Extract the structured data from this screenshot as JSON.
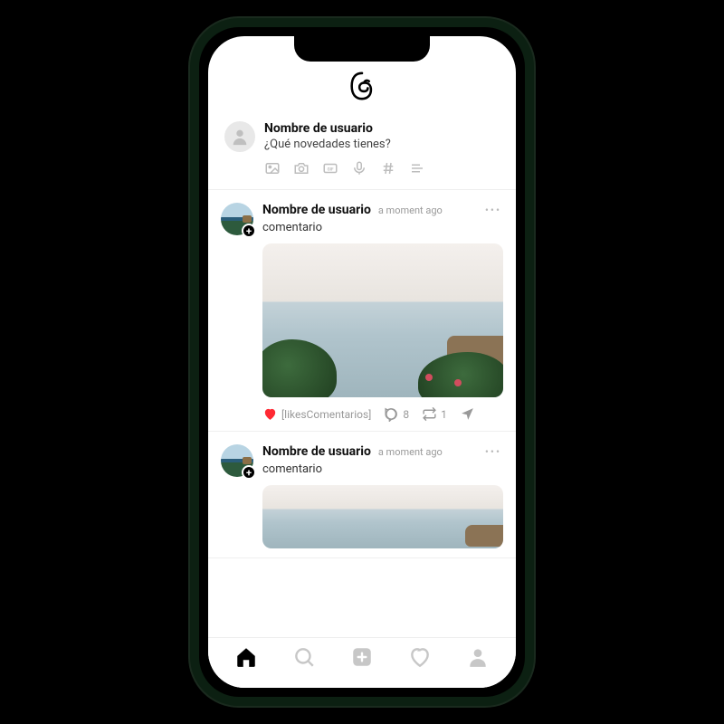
{
  "compose": {
    "username": "Nombre de usuario",
    "prompt": "¿Qué novedades tienes?"
  },
  "posts": [
    {
      "username": "Nombre de usuario",
      "time": "a moment ago",
      "text": "comentario",
      "likes_label": "[likesComentarios]",
      "comments": "8",
      "reposts": "1"
    },
    {
      "username": "Nombre de usuario",
      "time": "a moment ago",
      "text": "comentario"
    }
  ]
}
